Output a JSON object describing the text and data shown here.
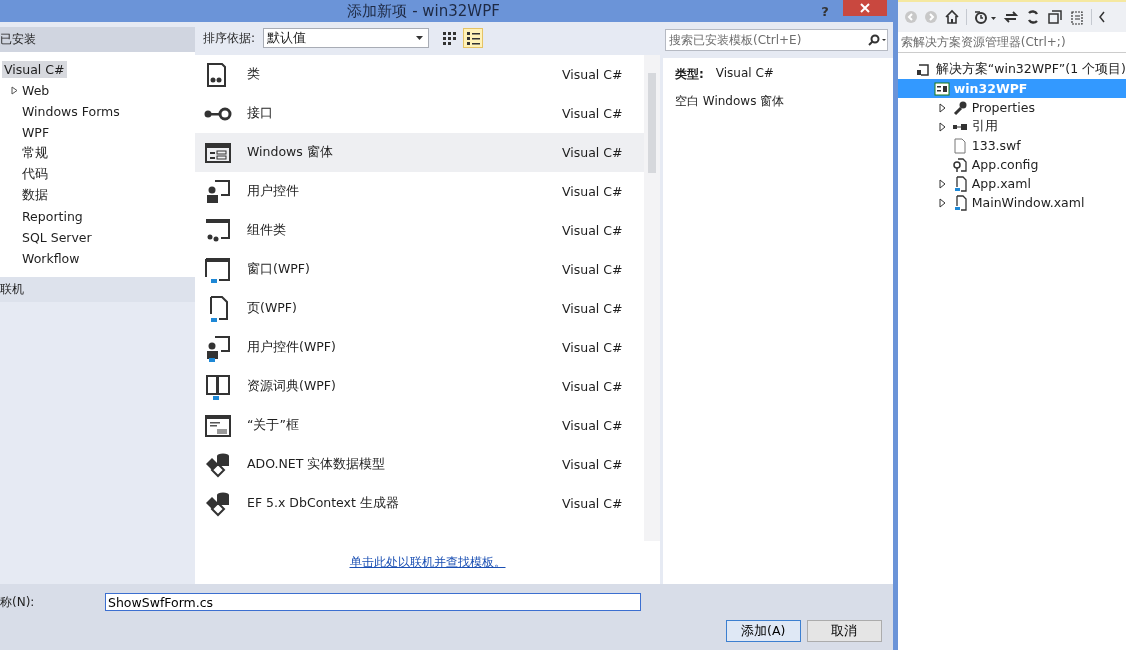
{
  "dialog": {
    "title": "添加新项 - win32WPF",
    "help": "?",
    "installed_header": "已安装",
    "categories": [
      {
        "label": "Visual C#",
        "selected": true,
        "children": [
          {
            "label": "Web",
            "selected": false,
            "expanded": false
          },
          {
            "label": "Windows Forms",
            "selected": false
          },
          {
            "label": "WPF",
            "selected": false
          },
          {
            "label": "常规",
            "selected": false
          },
          {
            "label": "代码",
            "selected": false
          },
          {
            "label": "数据",
            "selected": false
          },
          {
            "label": "Reporting",
            "selected": false
          },
          {
            "label": "SQL Server",
            "selected": false
          },
          {
            "label": "Workflow",
            "selected": false
          }
        ]
      }
    ],
    "online_header": "联机",
    "sort_label": "排序依据:",
    "sort_value": "默认值",
    "views": [
      {
        "kind": "grid",
        "selected": false
      },
      {
        "kind": "list",
        "selected": true
      }
    ],
    "search": {
      "placeholder": "搜索已安装模板(Ctrl+E)"
    },
    "templates": [
      {
        "kind": "class",
        "name": "类",
        "language": "Visual C#",
        "selected": false
      },
      {
        "kind": "interface",
        "name": "接口",
        "language": "Visual C#",
        "selected": false
      },
      {
        "kind": "form",
        "name": "Windows 窗体",
        "language": "Visual C#",
        "selected": true
      },
      {
        "kind": "usercontrol",
        "name": "用户控件",
        "language": "Visual C#",
        "selected": false
      },
      {
        "kind": "component",
        "name": "组件类",
        "language": "Visual C#",
        "selected": false
      },
      {
        "kind": "window",
        "name": "窗口(WPF)",
        "language": "Visual C#",
        "selected": false
      },
      {
        "kind": "page",
        "name": "页(WPF)",
        "language": "Visual C#",
        "selected": false
      },
      {
        "kind": "wpfcontrol",
        "name": "用户控件(WPF)",
        "language": "Visual C#",
        "selected": false
      },
      {
        "kind": "dictionary",
        "name": "资源词典(WPF)",
        "language": "Visual C#",
        "selected": false
      },
      {
        "kind": "about",
        "name": "“关于”框",
        "language": "Visual C#",
        "selected": false
      },
      {
        "kind": "data",
        "name": "ADO.NET 实体数据模型",
        "language": "Visual C#",
        "selected": false
      },
      {
        "kind": "data",
        "name": "EF 5.x DbContext 生成器",
        "language": "Visual C#",
        "selected": false
      }
    ],
    "details": {
      "type_label": "类型:",
      "type_value": "Visual C#",
      "description": "空白 Windows 窗体"
    },
    "online_link": "单击此处以联机并查找模板。",
    "name_label": "称(N):",
    "name_value": "ShowSwfForm.cs",
    "buttons": [
      {
        "label": "添加(A)",
        "kind": "default"
      },
      {
        "label": "取消",
        "kind": "normal"
      }
    ]
  },
  "explorer": {
    "search": {
      "placeholder": "索解决方案资源管理器(Ctrl+;)"
    },
    "tree": [
      {
        "label": "解决方案“win32WPF”(1 个项目)",
        "kind": "solution",
        "selected": false,
        "children": [
          {
            "label": "win32WPF",
            "kind": "project",
            "selected": true,
            "children": [
              {
                "label": "Properties",
                "kind": "wrench",
                "selected": false,
                "expanded": false
              },
              {
                "label": "引用",
                "kind": "reference",
                "selected": false,
                "expanded": false
              },
              {
                "label": "133.swf",
                "kind": "file",
                "selected": false
              },
              {
                "label": "App.config",
                "kind": "config",
                "selected": false
              },
              {
                "label": "App.xaml",
                "kind": "xaml",
                "selected": false,
                "expanded": false
              },
              {
                "label": "MainWindow.xaml",
                "kind": "xaml",
                "selected": false,
                "expanded": false
              }
            ]
          }
        ]
      }
    ]
  }
}
